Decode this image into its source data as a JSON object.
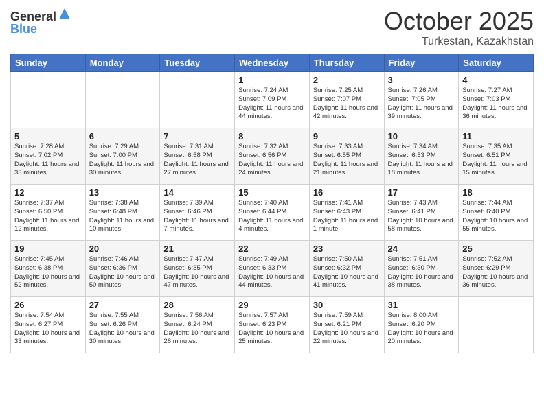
{
  "logo": {
    "general": "General",
    "blue": "Blue"
  },
  "title": "October 2025",
  "subtitle": "Turkestan, Kazakhstan",
  "weekdays": [
    "Sunday",
    "Monday",
    "Tuesday",
    "Wednesday",
    "Thursday",
    "Friday",
    "Saturday"
  ],
  "weeks": [
    [
      {
        "day": "",
        "info": ""
      },
      {
        "day": "",
        "info": ""
      },
      {
        "day": "",
        "info": ""
      },
      {
        "day": "1",
        "info": "Sunrise: 7:24 AM\nSunset: 7:09 PM\nDaylight: 11 hours\nand 44 minutes."
      },
      {
        "day": "2",
        "info": "Sunrise: 7:25 AM\nSunset: 7:07 PM\nDaylight: 11 hours\nand 42 minutes."
      },
      {
        "day": "3",
        "info": "Sunrise: 7:26 AM\nSunset: 7:05 PM\nDaylight: 11 hours\nand 39 minutes."
      },
      {
        "day": "4",
        "info": "Sunrise: 7:27 AM\nSunset: 7:03 PM\nDaylight: 11 hours\nand 36 minutes."
      }
    ],
    [
      {
        "day": "5",
        "info": "Sunrise: 7:28 AM\nSunset: 7:02 PM\nDaylight: 11 hours\nand 33 minutes."
      },
      {
        "day": "6",
        "info": "Sunrise: 7:29 AM\nSunset: 7:00 PM\nDaylight: 11 hours\nand 30 minutes."
      },
      {
        "day": "7",
        "info": "Sunrise: 7:31 AM\nSunset: 6:58 PM\nDaylight: 11 hours\nand 27 minutes."
      },
      {
        "day": "8",
        "info": "Sunrise: 7:32 AM\nSunset: 6:56 PM\nDaylight: 11 hours\nand 24 minutes."
      },
      {
        "day": "9",
        "info": "Sunrise: 7:33 AM\nSunset: 6:55 PM\nDaylight: 11 hours\nand 21 minutes."
      },
      {
        "day": "10",
        "info": "Sunrise: 7:34 AM\nSunset: 6:53 PM\nDaylight: 11 hours\nand 18 minutes."
      },
      {
        "day": "11",
        "info": "Sunrise: 7:35 AM\nSunset: 6:51 PM\nDaylight: 11 hours\nand 15 minutes."
      }
    ],
    [
      {
        "day": "12",
        "info": "Sunrise: 7:37 AM\nSunset: 6:50 PM\nDaylight: 11 hours\nand 12 minutes."
      },
      {
        "day": "13",
        "info": "Sunrise: 7:38 AM\nSunset: 6:48 PM\nDaylight: 11 hours\nand 10 minutes."
      },
      {
        "day": "14",
        "info": "Sunrise: 7:39 AM\nSunset: 6:46 PM\nDaylight: 11 hours\nand 7 minutes."
      },
      {
        "day": "15",
        "info": "Sunrise: 7:40 AM\nSunset: 6:44 PM\nDaylight: 11 hours\nand 4 minutes."
      },
      {
        "day": "16",
        "info": "Sunrise: 7:41 AM\nSunset: 6:43 PM\nDaylight: 11 hours\nand 1 minute."
      },
      {
        "day": "17",
        "info": "Sunrise: 7:43 AM\nSunset: 6:41 PM\nDaylight: 10 hours\nand 58 minutes."
      },
      {
        "day": "18",
        "info": "Sunrise: 7:44 AM\nSunset: 6:40 PM\nDaylight: 10 hours\nand 55 minutes."
      }
    ],
    [
      {
        "day": "19",
        "info": "Sunrise: 7:45 AM\nSunset: 6:38 PM\nDaylight: 10 hours\nand 52 minutes."
      },
      {
        "day": "20",
        "info": "Sunrise: 7:46 AM\nSunset: 6:36 PM\nDaylight: 10 hours\nand 50 minutes."
      },
      {
        "day": "21",
        "info": "Sunrise: 7:47 AM\nSunset: 6:35 PM\nDaylight: 10 hours\nand 47 minutes."
      },
      {
        "day": "22",
        "info": "Sunrise: 7:49 AM\nSunset: 6:33 PM\nDaylight: 10 hours\nand 44 minutes."
      },
      {
        "day": "23",
        "info": "Sunrise: 7:50 AM\nSunset: 6:32 PM\nDaylight: 10 hours\nand 41 minutes."
      },
      {
        "day": "24",
        "info": "Sunrise: 7:51 AM\nSunset: 6:30 PM\nDaylight: 10 hours\nand 38 minutes."
      },
      {
        "day": "25",
        "info": "Sunrise: 7:52 AM\nSunset: 6:29 PM\nDaylight: 10 hours\nand 36 minutes."
      }
    ],
    [
      {
        "day": "26",
        "info": "Sunrise: 7:54 AM\nSunset: 6:27 PM\nDaylight: 10 hours\nand 33 minutes."
      },
      {
        "day": "27",
        "info": "Sunrise: 7:55 AM\nSunset: 6:26 PM\nDaylight: 10 hours\nand 30 minutes."
      },
      {
        "day": "28",
        "info": "Sunrise: 7:56 AM\nSunset: 6:24 PM\nDaylight: 10 hours\nand 28 minutes."
      },
      {
        "day": "29",
        "info": "Sunrise: 7:57 AM\nSunset: 6:23 PM\nDaylight: 10 hours\nand 25 minutes."
      },
      {
        "day": "30",
        "info": "Sunrise: 7:59 AM\nSunset: 6:21 PM\nDaylight: 10 hours\nand 22 minutes."
      },
      {
        "day": "31",
        "info": "Sunrise: 8:00 AM\nSunset: 6:20 PM\nDaylight: 10 hours\nand 20 minutes."
      },
      {
        "day": "",
        "info": ""
      }
    ]
  ]
}
